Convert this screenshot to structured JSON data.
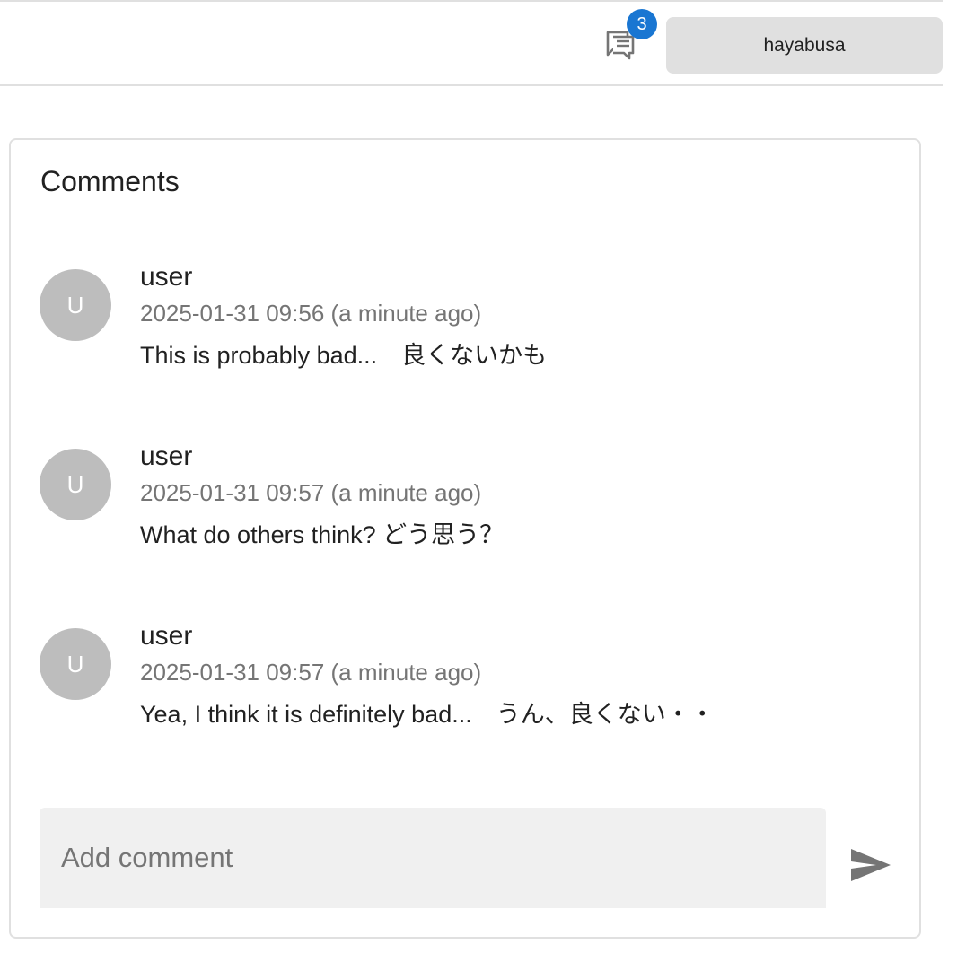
{
  "header": {
    "comments_icon": "comments-icon",
    "comment_count": "3",
    "user_button_label": "hayabusa",
    "badge_color": "#1976d2"
  },
  "comments_panel": {
    "title": "Comments",
    "items": [
      {
        "avatar_initial": "U",
        "author": "user",
        "timestamp": "2025-01-31 09:56 (a minute ago)",
        "text": "This is probably bad...　良くないかも"
      },
      {
        "avatar_initial": "U",
        "author": "user",
        "timestamp": "2025-01-31 09:57 (a minute ago)",
        "text": "What do others think? どう思う？"
      },
      {
        "avatar_initial": "U",
        "author": "user",
        "timestamp": "2025-01-31 09:57 (a minute ago)",
        "text": "Yea, I think it is definitely bad...　うん、良くない・・"
      }
    ],
    "add_comment": {
      "placeholder": "Add comment",
      "value": "",
      "send_icon": "send-icon"
    }
  }
}
